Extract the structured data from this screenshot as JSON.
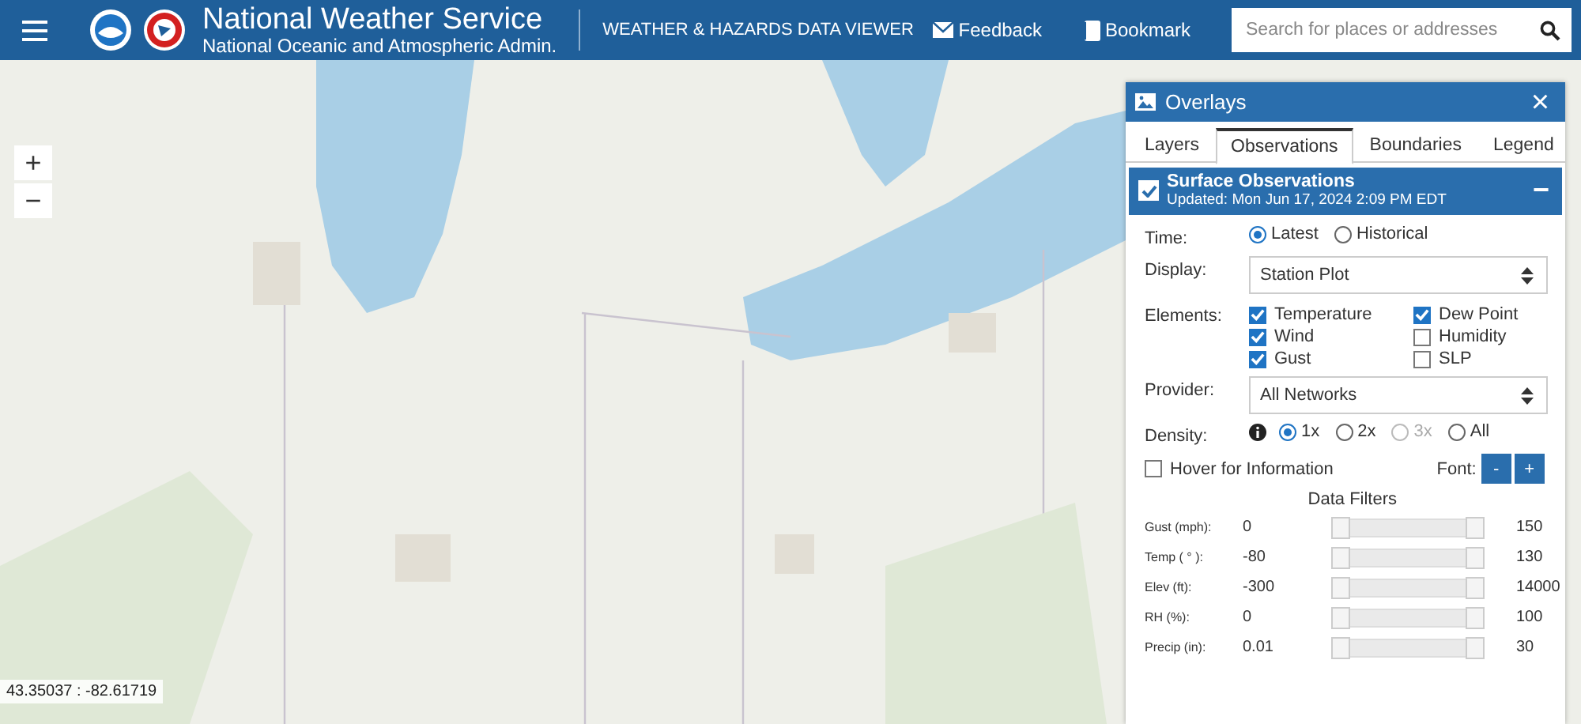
{
  "header": {
    "title": "National Weather Service",
    "subtitle": "National Oceanic and Atmospheric Admin.",
    "app_name": "WEATHER & HAZARDS DATA VIEWER",
    "links": [
      {
        "label": "Feedback",
        "kind": "feedback"
      },
      {
        "label": "Bookmark",
        "kind": "bookmark"
      }
    ],
    "search": {
      "placeholder": "Search for places or addresses"
    }
  },
  "map": {
    "zoom_in": "+",
    "zoom_out": "−",
    "coordinates": "43.35037 : -82.61719"
  },
  "overlays": {
    "title": "Overlays",
    "close": "×",
    "tabs": [
      {
        "label": "Layers",
        "selected": false
      },
      {
        "label": "Observations",
        "selected": true
      },
      {
        "label": "Boundaries",
        "selected": false
      },
      {
        "label": "Legend",
        "selected": false
      }
    ],
    "section": {
      "title": "Surface Observations",
      "updated": "Updated: Mon Jun 17, 2024 2:09 PM EDT",
      "checked": true,
      "collapse": "−"
    },
    "time": {
      "label": "Time:",
      "options": [
        {
          "label": "Latest",
          "selected": true
        },
        {
          "label": "Historical",
          "selected": false
        }
      ]
    },
    "display": {
      "label": "Display:",
      "value": "Station Plot"
    },
    "elements": {
      "label": "Elements:",
      "items": [
        {
          "label": "Temperature",
          "checked": true
        },
        {
          "label": "Dew Point",
          "checked": true
        },
        {
          "label": "Wind",
          "checked": true
        },
        {
          "label": "Humidity",
          "checked": false
        },
        {
          "label": "Gust",
          "checked": true
        },
        {
          "label": "SLP",
          "checked": false
        }
      ]
    },
    "provider": {
      "label": "Provider:",
      "value": "All Networks"
    },
    "density": {
      "label": "Density:",
      "options": [
        {
          "label": "1x",
          "selected": true,
          "disabled": false
        },
        {
          "label": "2x",
          "selected": false,
          "disabled": false
        },
        {
          "label": "3x",
          "selected": false,
          "disabled": true
        },
        {
          "label": "All",
          "selected": false,
          "disabled": false
        }
      ]
    },
    "hover": {
      "label": "Hover for Information",
      "checked": false
    },
    "font": {
      "label": "Font:",
      "buttons": [
        "-",
        "+"
      ]
    },
    "filters_title": "Data Filters",
    "filters": [
      {
        "label": "Gust (mph):",
        "min": "0",
        "max": "150",
        "level": 1
      },
      {
        "label": "Temp ( ° ):",
        "min": "-80",
        "max": "130",
        "level": 1
      },
      {
        "label": "Elev (ft):",
        "min": "-300",
        "max": "14000",
        "level": 1
      },
      {
        "label": "RH (%):",
        "min": "0",
        "max": "100",
        "level": 1
      },
      {
        "label": "Precip (in):",
        "min": "0.01",
        "max": "30",
        "level": 1
      }
    ]
  }
}
